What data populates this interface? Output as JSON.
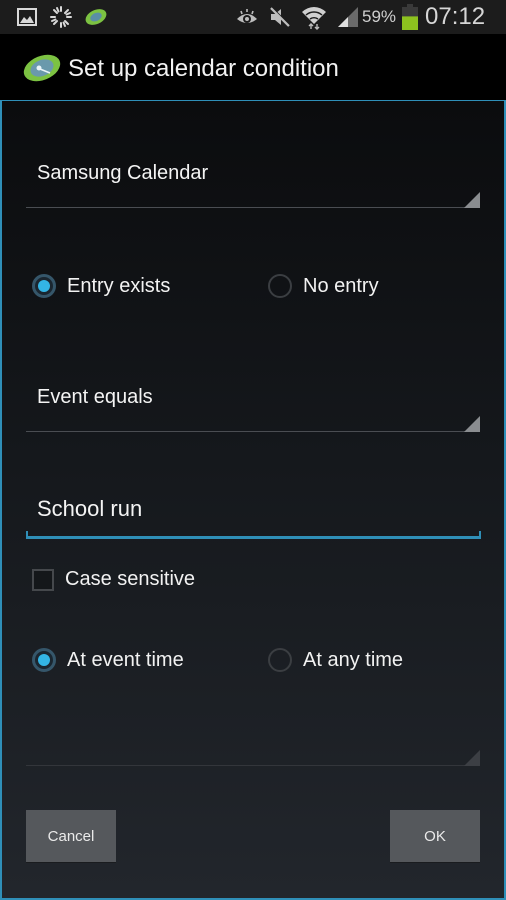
{
  "status_bar": {
    "left_icons": [
      "gallery-icon",
      "loading-spinner-icon",
      "app-notification-icon"
    ],
    "right_icons": [
      "eye-icon",
      "mute-icon",
      "wifi-icon",
      "signal-icon",
      "battery-icon"
    ],
    "battery_percent": "59%",
    "battery_level": 0.59,
    "time": "07:12",
    "battery_color": "#8dc21f"
  },
  "title_bar": {
    "title": "Set up calendar condition",
    "icon": "app-logo-icon"
  },
  "dialog": {
    "accent_color": "#33b5e5",
    "calendar_spinner": {
      "value": "Samsung Calendar"
    },
    "entry_radio_group": {
      "options": [
        {
          "label": "Entry exists",
          "checked": true
        },
        {
          "label": "No entry",
          "checked": false
        }
      ]
    },
    "match_spinner": {
      "value": "Event equals"
    },
    "event_text": {
      "value": "School run",
      "placeholder": ""
    },
    "case_sensitive": {
      "label": "Case sensitive",
      "checked": false
    },
    "time_radio_group": {
      "options": [
        {
          "label": "At event time",
          "checked": true
        },
        {
          "label": "At any time",
          "checked": false
        }
      ]
    },
    "extra_spinner": {
      "value": ""
    },
    "buttons": {
      "cancel": "Cancel",
      "ok": "OK"
    }
  }
}
